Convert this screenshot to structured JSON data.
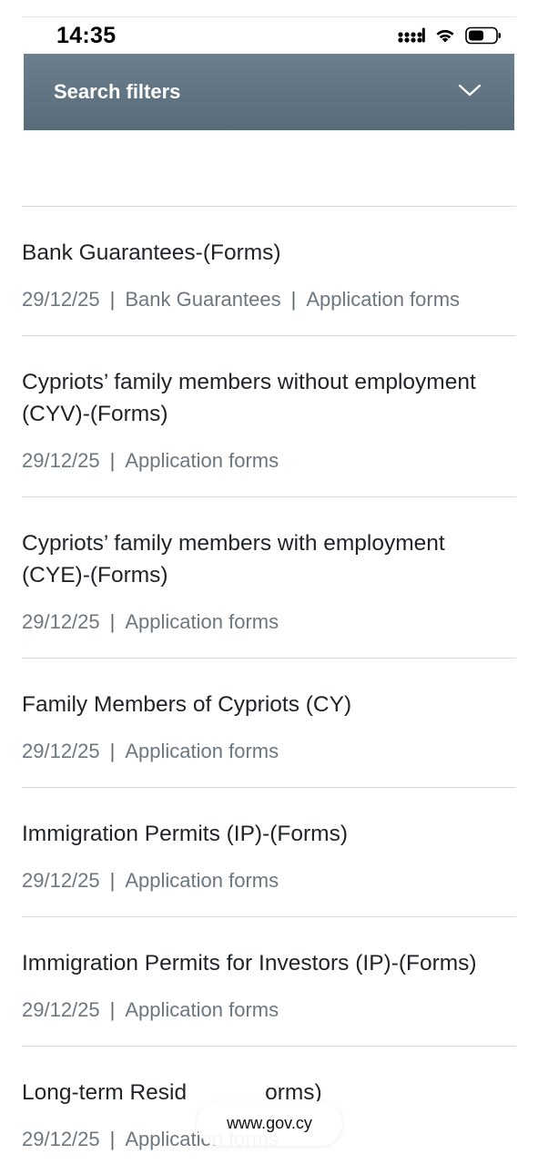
{
  "status_bar": {
    "time": "14:35"
  },
  "filters": {
    "label": "Search filters",
    "icon": "chevron-down-icon"
  },
  "results": [
    {
      "title": "Bank Guarantees-(Forms)",
      "date": "29/12/25",
      "tags": [
        "Bank Guarantees",
        "Application forms"
      ]
    },
    {
      "title": "Cypriots’ family members without employment (CYV)-(Forms)",
      "date": "29/12/25",
      "tags": [
        "Application forms"
      ]
    },
    {
      "title": "Cypriots’ family members with employment (CYE)-(Forms)",
      "date": "29/12/25",
      "tags": [
        "Application forms"
      ]
    },
    {
      "title": "Family Members of Cypriots (CY)",
      "date": "29/12/25",
      "tags": [
        "Application forms"
      ]
    },
    {
      "title": "Immigration Permits (IP)-(Forms)",
      "date": "29/12/25",
      "tags": [
        "Application forms"
      ]
    },
    {
      "title": "Immigration Permits for Investors (IP)-(Forms)",
      "date": "29/12/25",
      "tags": [
        "Application forms"
      ]
    },
    {
      "title": "Long-term Resid",
      "title_end": "orms)",
      "date": "29/12/25",
      "tags": [
        "Application forms"
      ]
    }
  ],
  "browser": {
    "url": "www.gov.cy"
  }
}
